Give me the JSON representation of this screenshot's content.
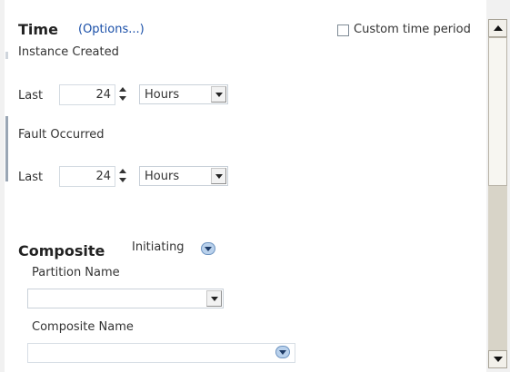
{
  "time": {
    "title": "Time",
    "options_link": "(Options...)",
    "custom_time_period_label": "Custom time period",
    "custom_time_period_checked": false,
    "instance_created": {
      "label": "Instance Created",
      "last_label": "Last",
      "value": "24",
      "unit": "Hours"
    },
    "fault_occurred": {
      "label": "Fault Occurred",
      "last_label": "Last",
      "value": "24",
      "unit": "Hours"
    }
  },
  "composite": {
    "title": "Composite",
    "mode": "Initiating",
    "partition_name_label": "Partition Name",
    "partition_name_value": "",
    "composite_name_label": "Composite Name",
    "composite_name_value": ""
  }
}
